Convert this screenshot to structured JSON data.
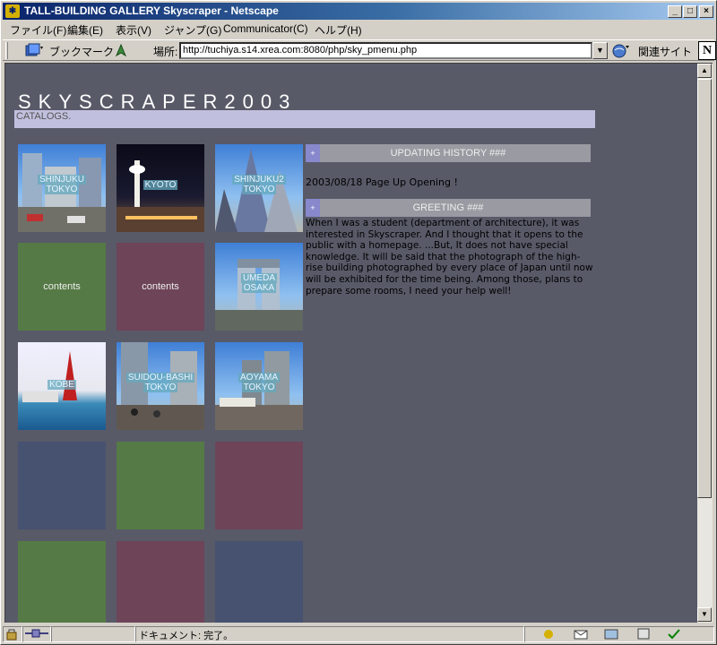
{
  "window": {
    "title": "TALL-BUILDING GALLERY Skyscraper - Netscape",
    "min": "_",
    "max": "□",
    "close": "×"
  },
  "menu": [
    "ファイル(F)",
    "編集(E)",
    "表示(V)",
    "ジャンプ(G)",
    "Communicator(C)",
    "ヘルプ(H)"
  ],
  "toolbar": {
    "bookmarks": "ブックマーク",
    "location_label": "場所:",
    "url": "http://tuchiya.s14.xrea.com:8080/php/sky_pmenu.php",
    "related": "関連サイト",
    "logo": "N"
  },
  "page": {
    "title": "SKYSCRAPER2003",
    "catalog": "CATALOGS.",
    "history_heading": "UPDATING HISTORY ###",
    "history_entry": "2003/08/18 Page Up Opening !",
    "greeting_heading": "GREETING ###",
    "greeting_text": "When I was a student (department of architecture), it was interested in Skyscraper. And I thought that it opens to the public with a homepage. ...But, It does not have special knowledge. It will be said that the photograph of the high-rise building photographed by every place of Japan until now will be exhibited for the time being. Among those, plans to prepare some rooms, I need your help well!",
    "plus": "+"
  },
  "tiles": {
    "shinjuku": [
      "SHINJUKU",
      "TOKYO"
    ],
    "kyoto": [
      "KYOTO"
    ],
    "shinjuku2": [
      "SHINJUKU2",
      "TOKYO"
    ],
    "contents1": "contents",
    "contents2": "contents",
    "umeda": [
      "UMEDA",
      "OSAKA"
    ],
    "kobe": [
      "KOBE"
    ],
    "suidoubashi": [
      "SUIDOU-BASHI",
      "TOKYO"
    ],
    "aoyama": [
      "AOYAMA",
      "TOKYO"
    ]
  },
  "colors": {
    "page_bg": "#585a68",
    "green_tile": "#557a45",
    "maroon_tile": "#6e4458",
    "blue_tile": "#465270"
  },
  "status": {
    "text": "ドキュメント: 完了。"
  }
}
